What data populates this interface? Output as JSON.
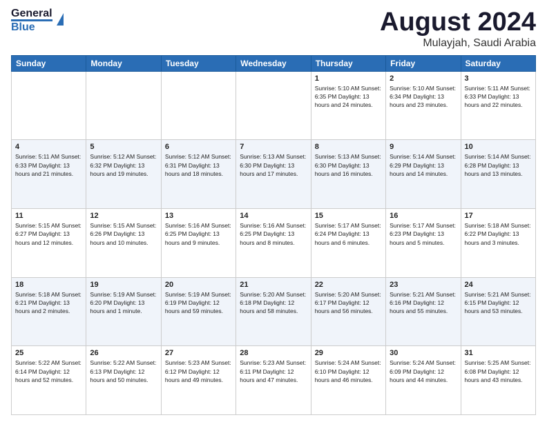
{
  "header": {
    "logo_top": "General",
    "logo_bottom": "Blue",
    "month_title": "August 2024",
    "location": "Mulayjah, Saudi Arabia"
  },
  "days_of_week": [
    "Sunday",
    "Monday",
    "Tuesday",
    "Wednesday",
    "Thursday",
    "Friday",
    "Saturday"
  ],
  "weeks": [
    [
      {
        "day": "",
        "info": ""
      },
      {
        "day": "",
        "info": ""
      },
      {
        "day": "",
        "info": ""
      },
      {
        "day": "",
        "info": ""
      },
      {
        "day": "1",
        "info": "Sunrise: 5:10 AM\nSunset: 6:35 PM\nDaylight: 13 hours\nand 24 minutes."
      },
      {
        "day": "2",
        "info": "Sunrise: 5:10 AM\nSunset: 6:34 PM\nDaylight: 13 hours\nand 23 minutes."
      },
      {
        "day": "3",
        "info": "Sunrise: 5:11 AM\nSunset: 6:33 PM\nDaylight: 13 hours\nand 22 minutes."
      }
    ],
    [
      {
        "day": "4",
        "info": "Sunrise: 5:11 AM\nSunset: 6:33 PM\nDaylight: 13 hours\nand 21 minutes."
      },
      {
        "day": "5",
        "info": "Sunrise: 5:12 AM\nSunset: 6:32 PM\nDaylight: 13 hours\nand 19 minutes."
      },
      {
        "day": "6",
        "info": "Sunrise: 5:12 AM\nSunset: 6:31 PM\nDaylight: 13 hours\nand 18 minutes."
      },
      {
        "day": "7",
        "info": "Sunrise: 5:13 AM\nSunset: 6:30 PM\nDaylight: 13 hours\nand 17 minutes."
      },
      {
        "day": "8",
        "info": "Sunrise: 5:13 AM\nSunset: 6:30 PM\nDaylight: 13 hours\nand 16 minutes."
      },
      {
        "day": "9",
        "info": "Sunrise: 5:14 AM\nSunset: 6:29 PM\nDaylight: 13 hours\nand 14 minutes."
      },
      {
        "day": "10",
        "info": "Sunrise: 5:14 AM\nSunset: 6:28 PM\nDaylight: 13 hours\nand 13 minutes."
      }
    ],
    [
      {
        "day": "11",
        "info": "Sunrise: 5:15 AM\nSunset: 6:27 PM\nDaylight: 13 hours\nand 12 minutes."
      },
      {
        "day": "12",
        "info": "Sunrise: 5:15 AM\nSunset: 6:26 PM\nDaylight: 13 hours\nand 10 minutes."
      },
      {
        "day": "13",
        "info": "Sunrise: 5:16 AM\nSunset: 6:25 PM\nDaylight: 13 hours\nand 9 minutes."
      },
      {
        "day": "14",
        "info": "Sunrise: 5:16 AM\nSunset: 6:25 PM\nDaylight: 13 hours\nand 8 minutes."
      },
      {
        "day": "15",
        "info": "Sunrise: 5:17 AM\nSunset: 6:24 PM\nDaylight: 13 hours\nand 6 minutes."
      },
      {
        "day": "16",
        "info": "Sunrise: 5:17 AM\nSunset: 6:23 PM\nDaylight: 13 hours\nand 5 minutes."
      },
      {
        "day": "17",
        "info": "Sunrise: 5:18 AM\nSunset: 6:22 PM\nDaylight: 13 hours\nand 3 minutes."
      }
    ],
    [
      {
        "day": "18",
        "info": "Sunrise: 5:18 AM\nSunset: 6:21 PM\nDaylight: 13 hours\nand 2 minutes."
      },
      {
        "day": "19",
        "info": "Sunrise: 5:19 AM\nSunset: 6:20 PM\nDaylight: 13 hours\nand 1 minute."
      },
      {
        "day": "20",
        "info": "Sunrise: 5:19 AM\nSunset: 6:19 PM\nDaylight: 12 hours\nand 59 minutes."
      },
      {
        "day": "21",
        "info": "Sunrise: 5:20 AM\nSunset: 6:18 PM\nDaylight: 12 hours\nand 58 minutes."
      },
      {
        "day": "22",
        "info": "Sunrise: 5:20 AM\nSunset: 6:17 PM\nDaylight: 12 hours\nand 56 minutes."
      },
      {
        "day": "23",
        "info": "Sunrise: 5:21 AM\nSunset: 6:16 PM\nDaylight: 12 hours\nand 55 minutes."
      },
      {
        "day": "24",
        "info": "Sunrise: 5:21 AM\nSunset: 6:15 PM\nDaylight: 12 hours\nand 53 minutes."
      }
    ],
    [
      {
        "day": "25",
        "info": "Sunrise: 5:22 AM\nSunset: 6:14 PM\nDaylight: 12 hours\nand 52 minutes."
      },
      {
        "day": "26",
        "info": "Sunrise: 5:22 AM\nSunset: 6:13 PM\nDaylight: 12 hours\nand 50 minutes."
      },
      {
        "day": "27",
        "info": "Sunrise: 5:23 AM\nSunset: 6:12 PM\nDaylight: 12 hours\nand 49 minutes."
      },
      {
        "day": "28",
        "info": "Sunrise: 5:23 AM\nSunset: 6:11 PM\nDaylight: 12 hours\nand 47 minutes."
      },
      {
        "day": "29",
        "info": "Sunrise: 5:24 AM\nSunset: 6:10 PM\nDaylight: 12 hours\nand 46 minutes."
      },
      {
        "day": "30",
        "info": "Sunrise: 5:24 AM\nSunset: 6:09 PM\nDaylight: 12 hours\nand 44 minutes."
      },
      {
        "day": "31",
        "info": "Sunrise: 5:25 AM\nSunset: 6:08 PM\nDaylight: 12 hours\nand 43 minutes."
      }
    ]
  ]
}
